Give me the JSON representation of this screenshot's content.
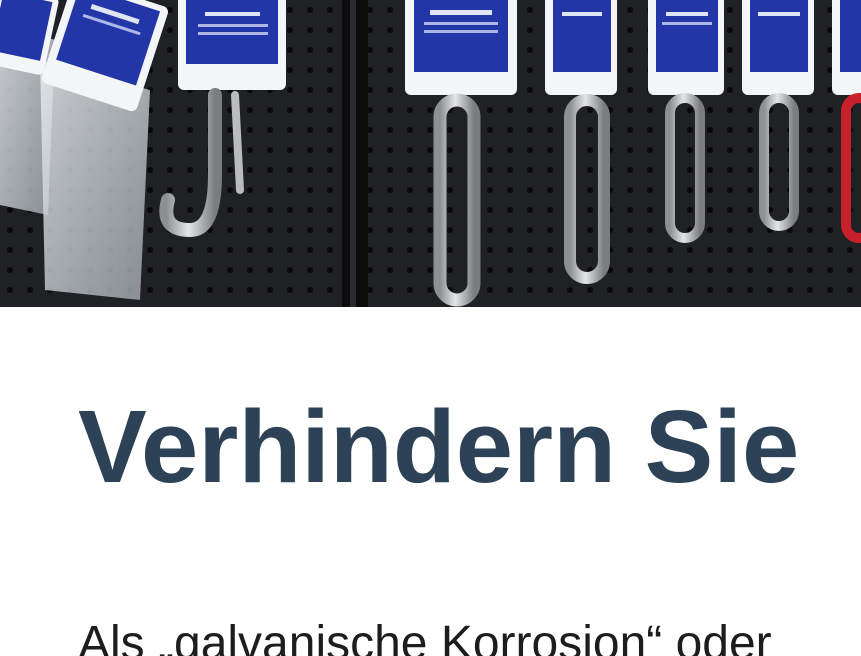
{
  "hero": {
    "image_name": "carabiner-hooks-display-photo",
    "product_tag_text": ""
  },
  "article": {
    "headline": "Verhindern Sie",
    "intro_text": "Als „galvanische Korrosion“ oder"
  },
  "colors": {
    "headline": "#2e4257",
    "tag_blue": "#2336a8",
    "pegboard": "#1a1b1d",
    "accent_red": "#c8202a"
  }
}
